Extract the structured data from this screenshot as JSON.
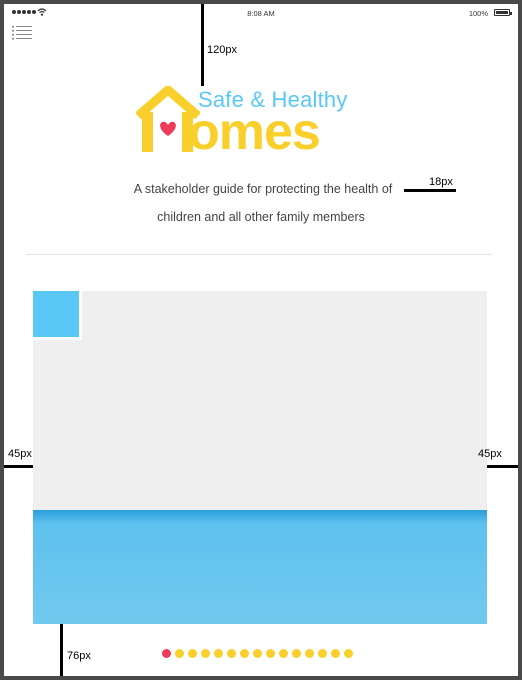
{
  "status_bar": {
    "time": "8:08 AM",
    "battery_label": "100%",
    "battery_level": 1.0
  },
  "header": {
    "menu_icon": "list-menu-icon"
  },
  "logo": {
    "tagline": "Safe & Healthy",
    "word": "omes",
    "house_icon": "house-heart-icon",
    "colors": {
      "tagline": "#5ac8f5",
      "word": "#f9cf2b",
      "heart": "#ef3b5a"
    }
  },
  "subtitle": {
    "line1": "A stakeholder guide for protecting the health of",
    "line2": "children and all other family members"
  },
  "hero": {
    "sky_color": "#efefef",
    "water_color": "#72c9ef",
    "thumb_color": "#5ac8f5"
  },
  "pagination": {
    "total": 15,
    "active_index": 0,
    "active_color": "#ef3b5a",
    "inactive_color": "#f9cf2b"
  },
  "annotations": {
    "top_margin": "120px",
    "subtitle_gap": "18px",
    "left_margin": "45px",
    "right_margin": "45px",
    "bottom_margin": "76px"
  }
}
